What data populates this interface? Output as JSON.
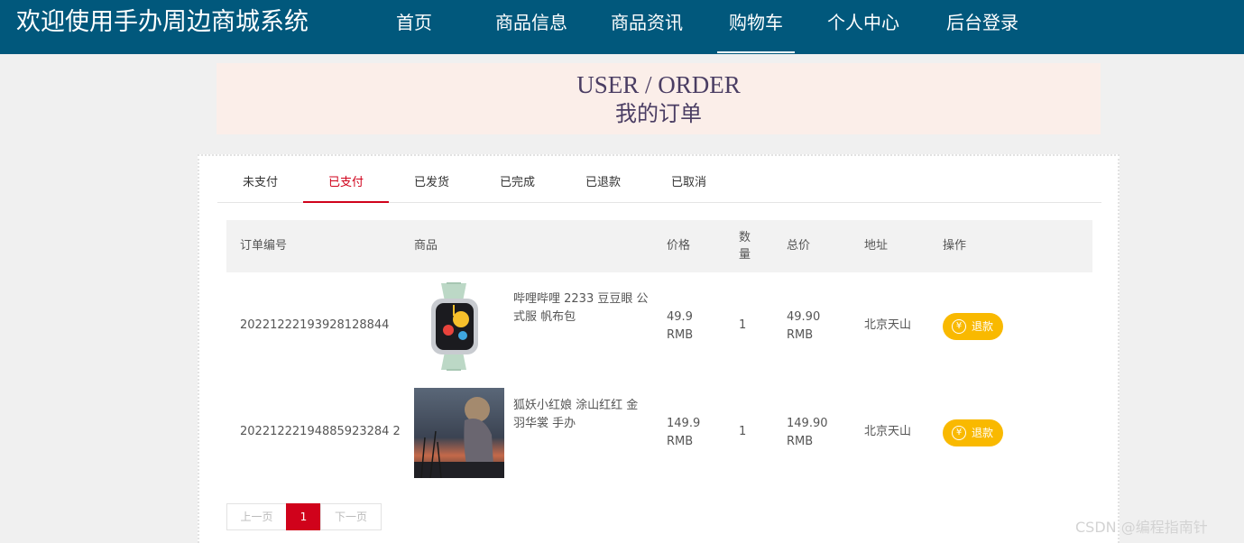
{
  "header": {
    "site_title": "欢迎使用手办周边商城系统",
    "nav": [
      "首页",
      "商品信息",
      "商品资讯",
      "购物车",
      "个人中心",
      "后台登录"
    ],
    "active_nav": "购物车"
  },
  "banner": {
    "en": "USER / ORDER",
    "cn": "我的订单"
  },
  "tabs": {
    "items": [
      "未支付",
      "已支付",
      "已发货",
      "已完成",
      "已退款",
      "已取消"
    ],
    "active": "已支付"
  },
  "table": {
    "headers": [
      "订单编号",
      "商品",
      "价格",
      "数量",
      "总价",
      "地址",
      "操作"
    ],
    "rows": [
      {
        "order_no": "20221222193928128844",
        "goods": "哔哩哔哩 2233 豆豆眼 公式服 帆布包",
        "price": "49.9",
        "price_unit": "RMB",
        "qty": "1",
        "total": "49.90",
        "total_unit": "RMB",
        "address": "北京天山",
        "action": "退款"
      },
      {
        "order_no": "20221222194885923284 2",
        "goods": "狐妖小红娘 涂山红红 金羽华裳 手办",
        "price": "149.9",
        "price_unit": "RMB",
        "qty": "1",
        "total": "149.90",
        "total_unit": "RMB",
        "address": "北京天山",
        "action": "退款"
      }
    ]
  },
  "pager": {
    "prev": "上一页",
    "current": "1",
    "next": "下一页"
  },
  "watermark": "CSDN @编程指南针",
  "colors": {
    "header_bg": "#01587c",
    "active_tab": "#d0021b",
    "refund_button": "#f9b900",
    "banner_bg": "#fbeee9"
  },
  "icons": {
    "refund": "yen-icon"
  }
}
